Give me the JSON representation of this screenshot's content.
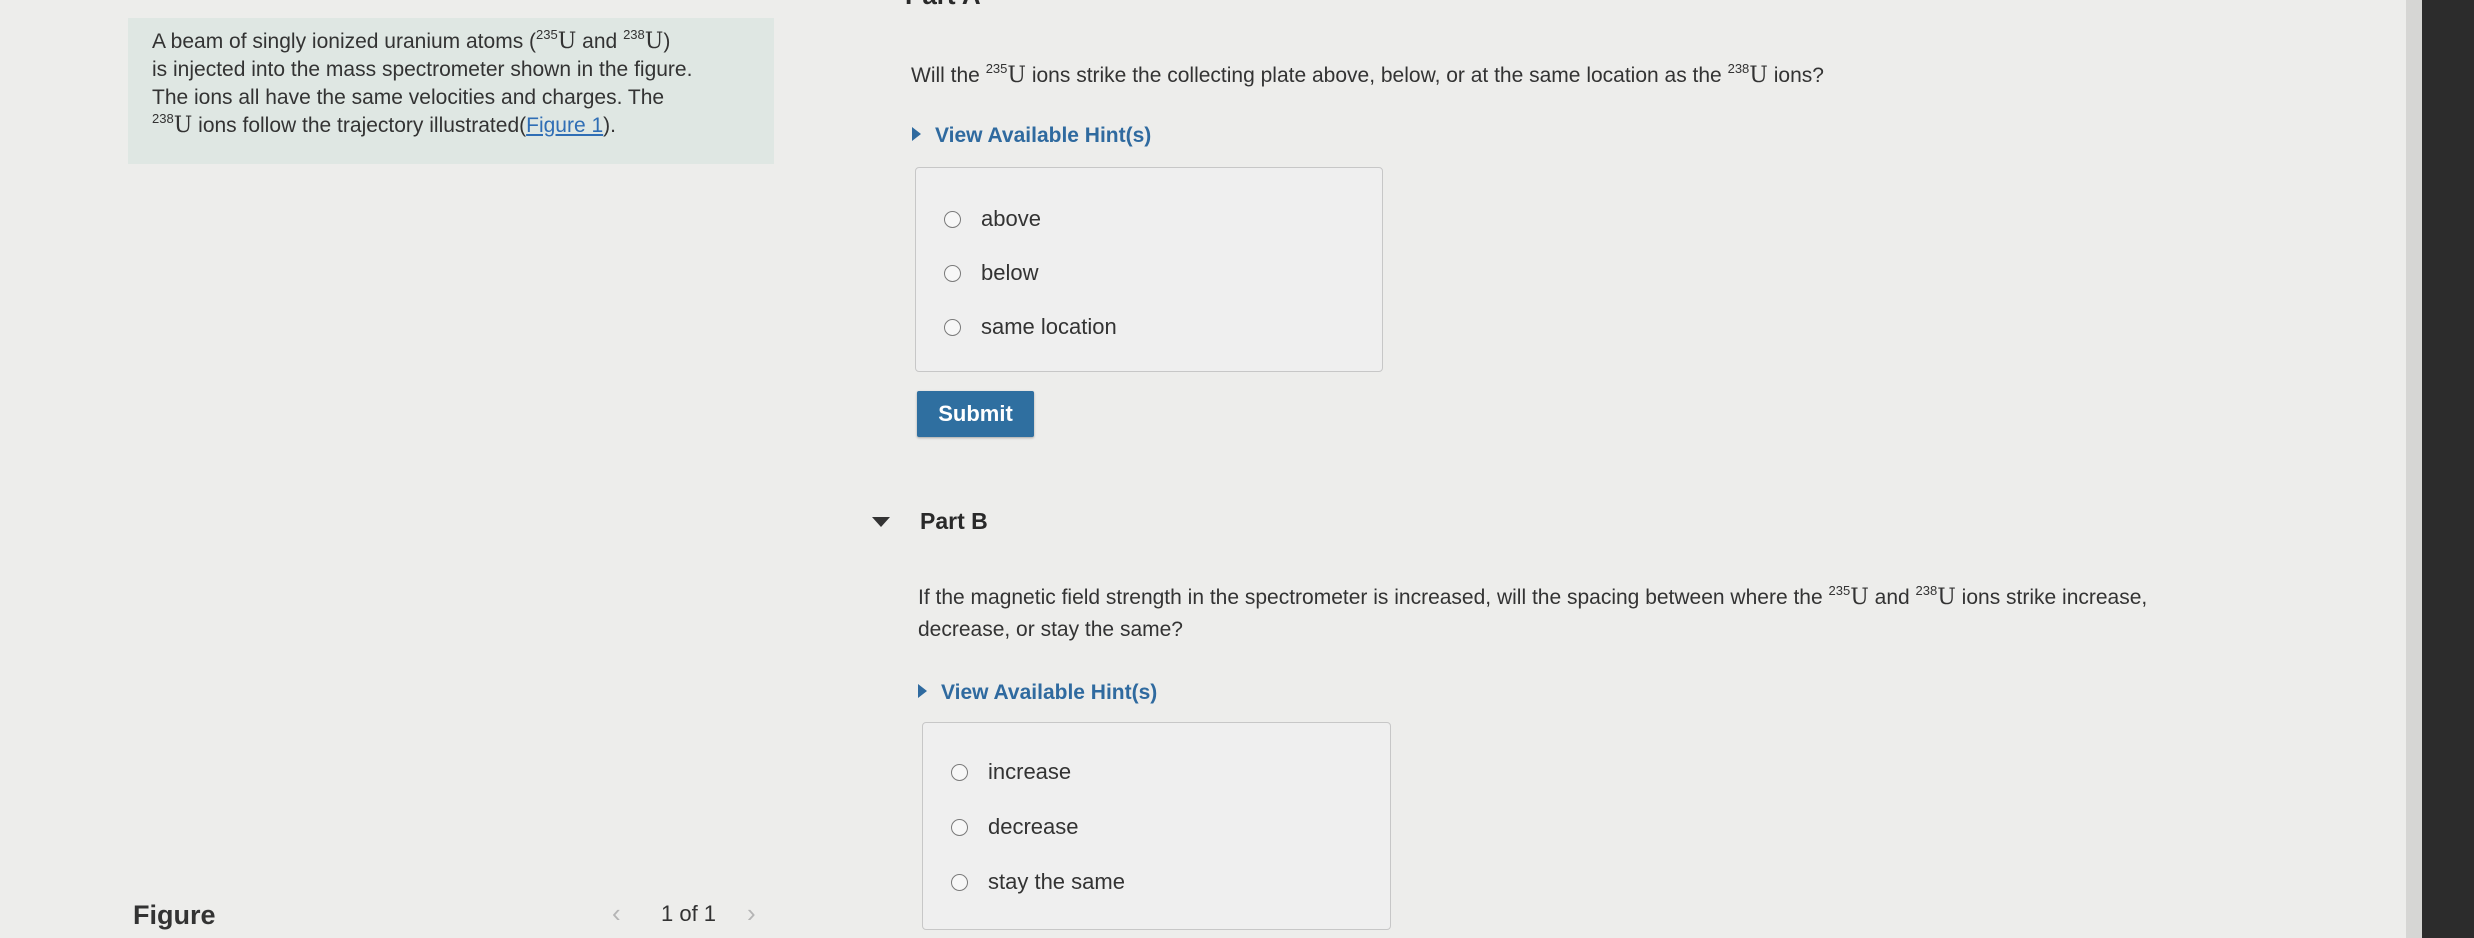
{
  "intro": {
    "t1": "A beam of singly ionized uranium atoms (",
    "sup1": "235",
    "u": "U",
    "and": " and ",
    "sup2": "238",
    "t2": ")",
    "t3": "is injected into the mass spectrometer shown in the figure.",
    "t4": "The ions all have the same velocities and charges. The",
    "sup3": "238",
    "t5": " ions follow the trajectory illustrated(",
    "link": "Figure 1",
    "t6": ")."
  },
  "figure": {
    "label": "Figure",
    "pager": "1 of 1",
    "prev_icon": "chevron-left-icon",
    "next_icon": "chevron-right-icon"
  },
  "partA": {
    "title": "Part A",
    "q1": "Will the ",
    "sup1": "235",
    "u": "U",
    "q2": " ions strike the collecting plate above, below, or at the same location as the ",
    "sup2": "238",
    "q3": " ions?",
    "hint": "View Available Hint(s)",
    "options": [
      "above",
      "below",
      "same location"
    ],
    "submit": "Submit"
  },
  "partB": {
    "title": "Part B",
    "q1": "If the magnetic field strength in the spectrometer is increased, will the spacing between where the ",
    "sup1": "235",
    "u": "U",
    "and": " and ",
    "sup2": "238",
    "q2": " ions strike increase,",
    "q3": "decrease, or stay the same?",
    "hint": "View Available Hint(s)",
    "options": [
      "increase",
      "decrease",
      "stay the same"
    ]
  },
  "colors": {
    "accent": "#2f6fa0",
    "link": "#2f6eb5",
    "intro_bg": "#dfe7e3",
    "page_bg": "#ededeb"
  }
}
